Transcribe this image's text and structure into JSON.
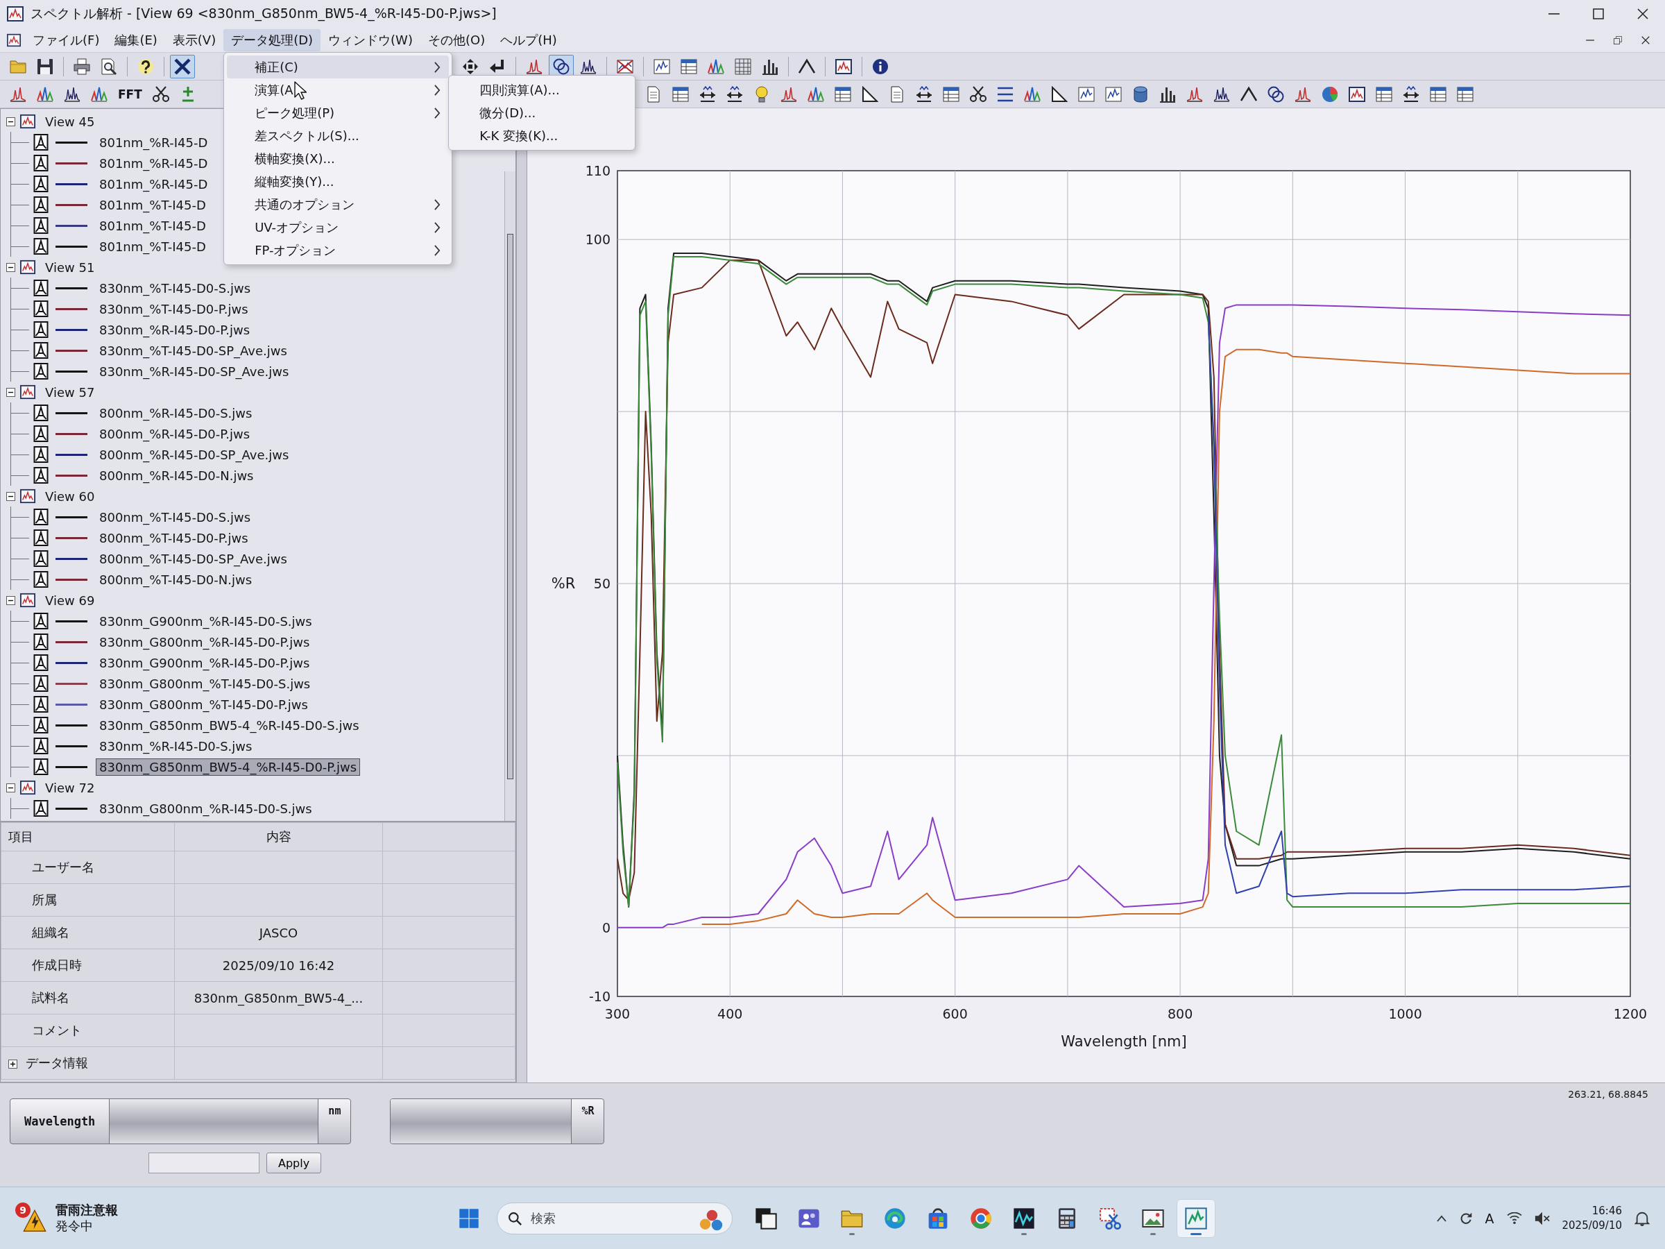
{
  "window": {
    "title": "スペクトル解析 - [View 69 <830nm_G850nm_BW5-4_%R-I45-D0-P.jws>]"
  },
  "menu_bar": [
    {
      "label": "ファイル(F)",
      "selected": false
    },
    {
      "label": "編集(E)",
      "selected": false
    },
    {
      "label": "表示(V)",
      "selected": false
    },
    {
      "label": "データ処理(D)",
      "selected": true,
      "items": [
        {
          "label": "補正(C)",
          "submenu": true,
          "selected": true
        },
        {
          "label": "演算(A",
          "submenu": true,
          "selected": false,
          "items": [
            {
              "label": "四則演算(A)...",
              "selected": false
            },
            {
              "label": "微分(D)...",
              "selected": false
            },
            {
              "label": "K-K 変換(K)...",
              "selected": false
            }
          ]
        },
        {
          "label": "ピーク処理(P)",
          "submenu": true,
          "selected": false
        },
        {
          "label": "差スペクトル(S)...",
          "submenu": false,
          "selected": false
        },
        {
          "label": "横軸変換(X)...",
          "submenu": false,
          "selected": false
        },
        {
          "label": "縦軸変換(Y)...",
          "submenu": false,
          "selected": false
        },
        {
          "label": "共通のオプション",
          "submenu": true,
          "selected": false
        },
        {
          "label": "UV-オプション",
          "submenu": true,
          "selected": false
        },
        {
          "label": "FP-オプション",
          "submenu": true,
          "selected": false
        }
      ]
    },
    {
      "label": "ウィンドウ(W)",
      "selected": false
    },
    {
      "label": "その他(O)",
      "selected": false
    },
    {
      "label": "ヘルプ(H)",
      "selected": false
    }
  ],
  "toolbars": [
    {
      "groups": [
        [
          {
            "selected": false
          },
          {
            "selected": false
          },
          {
            "selected": false
          },
          {
            "selected": false
          },
          {
            "selected": false
          },
          {
            "selected": true
          }
        ],
        [
          {
            "selected": false
          },
          {
            "selected": false
          },
          {
            "selected": false
          },
          {
            "selected": true
          },
          {
            "selected": false
          },
          {
            "selected": false
          },
          {
            "selected": false
          },
          {
            "selected": false
          },
          {
            "selected": false
          },
          {
            "selected": false
          },
          {
            "selected": false
          },
          {
            "selected": false
          },
          {
            "selected": false
          },
          {
            "selected": false
          }
        ]
      ]
    },
    {
      "groups": [
        [
          {
            "selected": false
          },
          {
            "selected": false
          },
          {
            "selected": false
          },
          {
            "selected": false
          },
          {
            "label": "FFT",
            "selected": false
          },
          {
            "selected": false
          },
          {
            "selected": false
          }
        ],
        [
          {
            "selected": false
          },
          {
            "selected": false
          },
          {
            "selected": false
          },
          {
            "selected": false
          },
          {
            "selected": false
          },
          {
            "selected": false
          },
          {
            "selected": false
          },
          {
            "selected": false
          },
          {
            "selected": false
          },
          {
            "selected": false
          },
          {
            "selected": false
          },
          {
            "selected": false
          },
          {
            "selected": false
          },
          {
            "selected": false
          },
          {
            "selected": false
          },
          {
            "selected": false
          },
          {
            "selected": false
          },
          {
            "selected": false
          },
          {
            "selected": false
          },
          {
            "selected": false
          },
          {
            "selected": false
          },
          {
            "selected": false
          },
          {
            "selected": false
          },
          {
            "selected": false
          },
          {
            "selected": false
          },
          {
            "selected": false
          },
          {
            "selected": false
          },
          {
            "selected": false
          },
          {
            "selected": false
          },
          {
            "selected": false
          },
          {
            "selected": false
          }
        ]
      ]
    }
  ],
  "tree": [
    {
      "label": "View 45",
      "expanded": true,
      "selected": false,
      "children": [
        {
          "label": "801nm_%R-I45-D",
          "color": "#141414",
          "selected": false
        },
        {
          "label": "801nm_%R-I45-D",
          "color": "#7a2838",
          "selected": false
        },
        {
          "label": "801nm_%R-I45-D",
          "color": "#1c2478",
          "selected": false
        },
        {
          "label": "801nm_%T-I45-D",
          "color": "#7a2838",
          "selected": false
        },
        {
          "label": "801nm_%T-I45-D",
          "color": "#3a3a80",
          "selected": false
        },
        {
          "label": "801nm_%T-I45-D",
          "color": "#141414",
          "selected": false
        }
      ]
    },
    {
      "label": "View 51",
      "expanded": true,
      "selected": false,
      "children": [
        {
          "label": "830nm_%T-I45-D0-S.jws",
          "color": "#141414",
          "selected": false
        },
        {
          "label": "830nm_%T-I45-D0-P.jws",
          "color": "#7a2838",
          "selected": false
        },
        {
          "label": "830nm_%R-I45-D0-P.jws",
          "color": "#1c2478",
          "selected": false
        },
        {
          "label": "830nm_%T-I45-D0-SP_Ave.jws",
          "color": "#7a2838",
          "selected": false
        },
        {
          "label": "830nm_%R-I45-D0-SP_Ave.jws",
          "color": "#141414",
          "selected": false
        }
      ]
    },
    {
      "label": "View 57",
      "expanded": true,
      "selected": false,
      "children": [
        {
          "label": "800nm_%R-I45-D0-S.jws",
          "color": "#141414",
          "selected": false
        },
        {
          "label": "800nm_%R-I45-D0-P.jws",
          "color": "#7a2838",
          "selected": false
        },
        {
          "label": "800nm_%R-I45-D0-SP_Ave.jws",
          "color": "#1c2478",
          "selected": false
        },
        {
          "label": "800nm_%R-I45-D0-N.jws",
          "color": "#7a2838",
          "selected": false
        }
      ]
    },
    {
      "label": "View 60",
      "expanded": true,
      "selected": false,
      "children": [
        {
          "label": "800nm_%T-I45-D0-S.jws",
          "color": "#141414",
          "selected": false
        },
        {
          "label": "800nm_%T-I45-D0-P.jws",
          "color": "#7a2838",
          "selected": false
        },
        {
          "label": "800nm_%T-I45-D0-SP_Ave.jws",
          "color": "#1c2478",
          "selected": false
        },
        {
          "label": "800nm_%T-I45-D0-N.jws",
          "color": "#7a2838",
          "selected": false
        }
      ]
    },
    {
      "label": "View 69",
      "expanded": true,
      "selected": false,
      "children": [
        {
          "label": "830nm_G900nm_%R-I45-D0-S.jws",
          "color": "#141414",
          "selected": false
        },
        {
          "label": "830nm_G800nm_%R-I45-D0-P.jws",
          "color": "#7a2838",
          "selected": false
        },
        {
          "label": "830nm_G900nm_%R-I45-D0-P.jws",
          "color": "#1c2478",
          "selected": false
        },
        {
          "label": "830nm_G800nm_%T-I45-D0-S.jws",
          "color": "#8a4050",
          "selected": false
        },
        {
          "label": "830nm_G800nm_%T-I45-D0-P.jws",
          "color": "#5a5aa8",
          "selected": false
        },
        {
          "label": "830nm_G850nm_BW5-4_%R-I45-D0-S.jws",
          "color": "#141414",
          "selected": false
        },
        {
          "label": "830nm_%R-I45-D0-S.jws",
          "color": "#141414",
          "selected": false
        },
        {
          "label": "830nm_G850nm_BW5-4_%R-I45-D0-P.jws",
          "color": "#141414",
          "selected": true
        }
      ]
    },
    {
      "label": "View 72",
      "expanded": true,
      "selected": false,
      "children": [
        {
          "label": "830nm_G800nm_%R-I45-D0-S.jws",
          "color": "#141414",
          "selected": false
        }
      ]
    }
  ],
  "properties": {
    "columns": [
      "項目",
      "内容"
    ],
    "rows": [
      {
        "label": "ユーザー名"
      },
      {
        "label": "所属"
      },
      {
        "label": "組織名",
        "value": "JASCO"
      },
      {
        "label": "作成日時",
        "value": "2025/09/10 16:42"
      },
      {
        "label": "試料名",
        "value": "830nm_G850nm_BW5-4_..."
      },
      {
        "label": "コメント"
      },
      {
        "label": "データ情報",
        "expanded": false
      }
    ]
  },
  "chart": {
    "chart_data": {
      "type": "line",
      "xlabel": "Wavelength [nm]",
      "ylabel": "%R",
      "grid": true,
      "x": [
        300,
        305,
        310,
        315,
        320,
        325,
        330,
        335,
        340,
        345,
        350,
        375,
        400,
        425,
        450,
        460,
        475,
        490,
        500,
        525,
        540,
        550,
        575,
        580,
        600,
        650,
        700,
        710,
        750,
        800,
        820,
        825,
        830,
        835,
        840,
        850,
        870,
        890,
        895,
        900,
        950,
        1000,
        1050,
        1100,
        1150,
        1200
      ],
      "series": [
        {
          "color": "#1e1e1e",
          "values": [
            25,
            12,
            3,
            20,
            90,
            92,
            70,
            40,
            28,
            90,
            98,
            98,
            97.5,
            97,
            94,
            95,
            95,
            95,
            95,
            95,
            94,
            94,
            91,
            93,
            94,
            94,
            93.5,
            93.5,
            93,
            92.5,
            92,
            90,
            60,
            25,
            15,
            9,
            9,
            10,
            10,
            10,
            10.5,
            11,
            11,
            11.5,
            11,
            10
          ]
        },
        {
          "color": "#6a2a1c",
          "values": [
            10,
            5,
            4,
            8,
            40,
            75,
            60,
            30,
            40,
            85,
            92,
            93,
            97,
            97,
            86,
            88,
            84,
            90,
            87,
            80,
            91,
            87,
            85,
            82,
            92,
            91,
            89,
            87,
            92,
            92,
            92,
            91,
            80,
            40,
            15,
            10,
            10,
            10.5,
            11,
            11,
            11,
            11.5,
            11.5,
            12,
            11.5,
            10.5
          ]
        },
        {
          "color": "#8a3cc8",
          "values": [
            0,
            0,
            0,
            0,
            0,
            0,
            0,
            0,
            0,
            0.5,
            0.5,
            1.5,
            1.5,
            2,
            7,
            11,
            13,
            9,
            5,
            6,
            14,
            7,
            12,
            16,
            4,
            5,
            7,
            9,
            3,
            3.5,
            4,
            10,
            50,
            85,
            90,
            90.5,
            90.5,
            90.5,
            90.5,
            90.5,
            90.3,
            90,
            89.8,
            89.5,
            89.2,
            89
          ]
        },
        {
          "color": "#d06a28",
          "values": [
            null,
            null,
            null,
            null,
            null,
            null,
            null,
            null,
            null,
            null,
            null,
            0.5,
            0.5,
            1,
            2,
            4,
            2,
            1.5,
            1.5,
            2,
            2,
            2,
            5,
            4,
            1.5,
            1.5,
            1.5,
            1.5,
            2,
            2,
            3,
            5,
            30,
            75,
            83,
            84,
            84,
            83.5,
            83.5,
            83,
            82.5,
            82,
            81.5,
            81,
            80.5,
            80.5
          ]
        },
        {
          "color": "#3a8a3a",
          "values": [
            24,
            11,
            3,
            19,
            89,
            91,
            69,
            39,
            27,
            89,
            97.5,
            97.5,
            97,
            96.5,
            93.5,
            94.5,
            94.5,
            94.5,
            94.5,
            94.5,
            93.5,
            93.5,
            90.5,
            92.5,
            93.5,
            93.5,
            93,
            93,
            92.5,
            92,
            91.5,
            88,
            70,
            45,
            25,
            14,
            12,
            28,
            4,
            3,
            3,
            3,
            3,
            3.5,
            3.5,
            3.5
          ]
        },
        {
          "color": "#3040b0",
          "values": [
            null,
            null,
            null,
            null,
            null,
            null,
            null,
            null,
            null,
            null,
            null,
            null,
            null,
            null,
            null,
            null,
            null,
            null,
            null,
            null,
            null,
            null,
            null,
            null,
            null,
            null,
            null,
            null,
            null,
            null,
            null,
            89,
            70,
            35,
            12,
            5,
            6,
            14,
            5,
            4.5,
            5,
            5,
            5.5,
            5.5,
            5.5,
            6
          ]
        }
      ],
      "xlim": [
        300,
        1200
      ],
      "ylim": [
        -10,
        110
      ],
      "xticks": [
        300,
        400,
        600,
        800,
        1000,
        1200
      ],
      "yticks": [
        -10,
        0,
        50,
        100,
        110
      ]
    }
  },
  "readout_bar": {
    "x_label": "Wavelength",
    "x_unit": "nm",
    "y_unit": "%R",
    "apply_button": "Apply",
    "cursor_position": "263.21, 68.8845"
  },
  "taskbar": {
    "weather": {
      "badge": "9",
      "title": "雷雨注意報",
      "status": "発令中"
    },
    "search": {
      "placeholder": "検索"
    },
    "apps": [
      {
        "running": false,
        "selected": false
      },
      {
        "running": false,
        "selected": false
      },
      {
        "running": true,
        "selected": false
      },
      {
        "running": false,
        "selected": false
      },
      {
        "running": false,
        "selected": false
      },
      {
        "running": false,
        "selected": false
      },
      {
        "running": true,
        "selected": false
      },
      {
        "running": false,
        "selected": false
      },
      {
        "running": false,
        "selected": false
      },
      {
        "running": true,
        "selected": false
      },
      {
        "running": true,
        "selected": true
      }
    ],
    "tray": {
      "ime": "A",
      "time": "16:46",
      "date": "2025/09/10"
    }
  }
}
